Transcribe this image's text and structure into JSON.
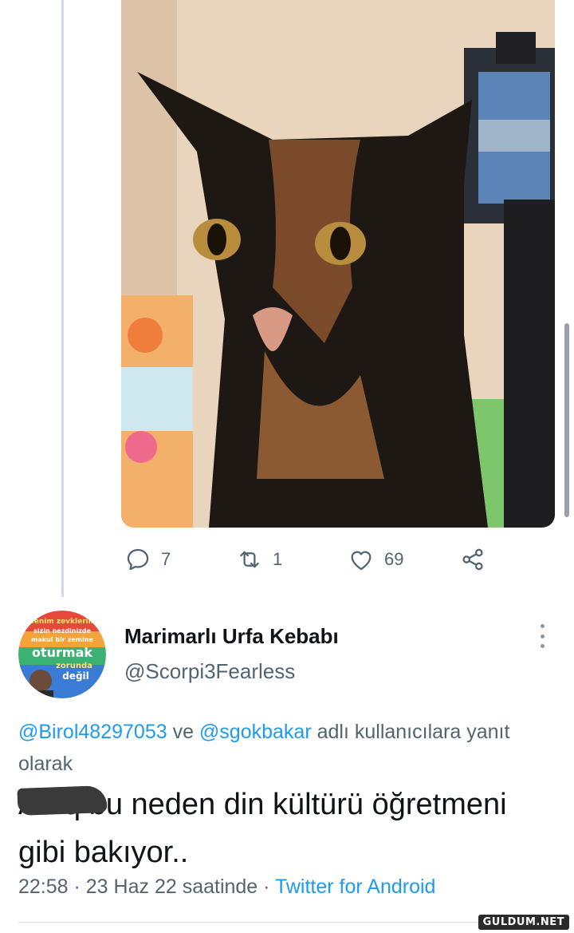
{
  "tweet_actions": {
    "reply_count": "7",
    "retweet_count": "1",
    "like_count": "69"
  },
  "reply": {
    "display_name": "Marimarlı Urfa Kebabı",
    "handle": "@Scorpi3Fearless",
    "replying_to": {
      "user1": "@Birol48297053",
      "connector": " ve ",
      "user2": "@sgokbakar",
      "suffix": " adlı kullanıcılara yanıt olarak"
    },
    "text": "Amq bu neden din kültürü öğretmeni gibi bakıyor..",
    "time": "22:58",
    "separator": " · ",
    "date": "23 Haz 22 saatinde",
    "source": "Twitter for Android"
  },
  "avatar_text": {
    "line1": "Benim zevklerim",
    "line2": "sizin nezdinizde",
    "line3": "makul bir zemine",
    "line4": "oturmak",
    "line5": "zorunda",
    "line6": "değil"
  },
  "watermark": "GULDUM.NET",
  "colors": {
    "accent": "#1d9bf0",
    "secondary_text": "#536471",
    "primary_text": "#0f1419"
  }
}
